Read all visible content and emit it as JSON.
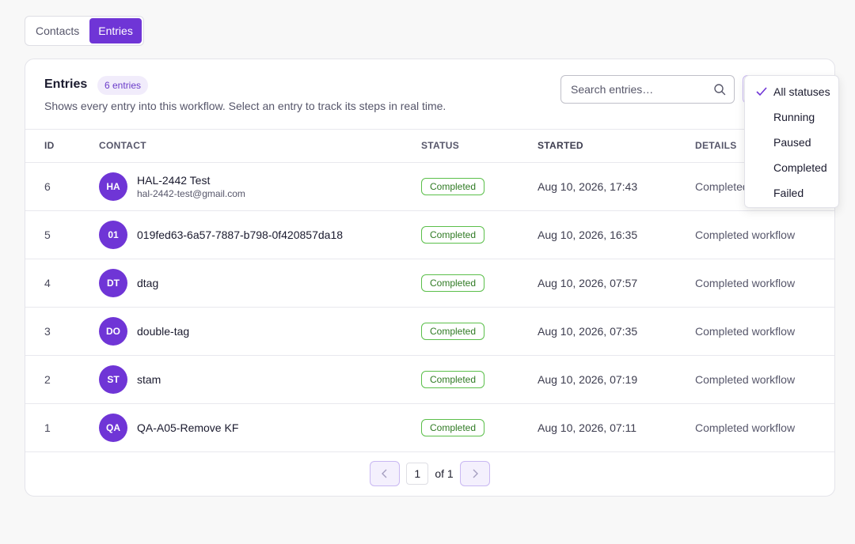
{
  "tabs": [
    {
      "label": "Contacts",
      "active": false
    },
    {
      "label": "Entries",
      "active": true
    }
  ],
  "card": {
    "title": "Entries",
    "count_badge": "6 entries",
    "description": "Shows every entry into this workflow. Select an entry to track its steps in real time."
  },
  "search": {
    "placeholder": "Search entries…",
    "value": ""
  },
  "status_filter": {
    "selected": "All statuses",
    "options": [
      "All statuses",
      "Running",
      "Paused",
      "Completed",
      "Failed"
    ]
  },
  "table": {
    "columns": [
      "ID",
      "CONTACT",
      "STATUS",
      "STARTED",
      "DETAILS"
    ],
    "rows": [
      {
        "id": "6",
        "initials": "HA",
        "name": "HAL-2442 Test",
        "email": "hal-2442-test@gmail.com",
        "status": "Completed",
        "started": "Aug 10, 2026, 17:43",
        "details": "Completed workflow"
      },
      {
        "id": "5",
        "initials": "01",
        "name": "019fed63-6a57-7887-b798-0f420857da18",
        "email": "",
        "status": "Completed",
        "started": "Aug 10, 2026, 16:35",
        "details": "Completed workflow"
      },
      {
        "id": "4",
        "initials": "DT",
        "name": "dtag",
        "email": "",
        "status": "Completed",
        "started": "Aug 10, 2026, 07:57",
        "details": "Completed workflow"
      },
      {
        "id": "3",
        "initials": "DO",
        "name": "double-tag",
        "email": "",
        "status": "Completed",
        "started": "Aug 10, 2026, 07:35",
        "details": "Completed workflow"
      },
      {
        "id": "2",
        "initials": "ST",
        "name": "stam",
        "email": "",
        "status": "Completed",
        "started": "Aug 10, 2026, 07:19",
        "details": "Completed workflow"
      },
      {
        "id": "1",
        "initials": "QA",
        "name": "QA-A05-Remove KF",
        "email": "",
        "status": "Completed",
        "started": "Aug 10, 2026, 07:11",
        "details": "Completed workflow"
      }
    ]
  },
  "pagination": {
    "current": "1",
    "of_label": "of 1"
  },
  "colors": {
    "accent": "#6f35d6",
    "status_completed": "#5bbf4a"
  }
}
